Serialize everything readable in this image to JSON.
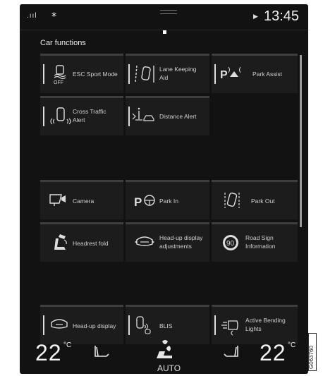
{
  "status": {
    "clock": "13:45",
    "signal": ".ııl",
    "bluetooth": "∗"
  },
  "title": "Car functions",
  "tiles": [
    {
      "label": "ESC Sport Mode",
      "icon": "esc-off-icon",
      "icon_text": "OFF"
    },
    {
      "label": "Lane Keeping\nAid",
      "icon": "lane-keeping-icon"
    },
    {
      "label": "Park Assist",
      "icon": "park-assist-icon",
      "icon_text": "P"
    },
    {
      "label": "Cross Traffic\nAlert",
      "icon": "cross-traffic-icon"
    },
    {
      "label": "Distance Alert",
      "icon": "distance-alert-icon"
    },
    {
      "label": "Camera",
      "icon": "camera-icon"
    },
    {
      "label": "Park In",
      "icon": "park-in-icon",
      "icon_text": "P"
    },
    {
      "label": "Park Out",
      "icon": "park-out-icon"
    },
    {
      "label": "Headrest fold",
      "icon": "headrest-fold-icon"
    },
    {
      "label": "Head-up display\nadjustments",
      "icon": "hud-adjust-icon"
    },
    {
      "label": "Road Sign\nInformation",
      "icon": "road-sign-icon",
      "icon_text": "90"
    },
    {
      "label": "Head-up display",
      "icon": "head-up-display-icon"
    },
    {
      "label": "BLIS",
      "icon": "blis-icon"
    },
    {
      "label": "Active Bending\nLights",
      "icon": "bending-lights-icon"
    }
  ],
  "climate": {
    "left_temp": "22",
    "right_temp": "22",
    "unit": "°C",
    "fan_mode": "AUTO"
  },
  "figure_id": "G063760"
}
